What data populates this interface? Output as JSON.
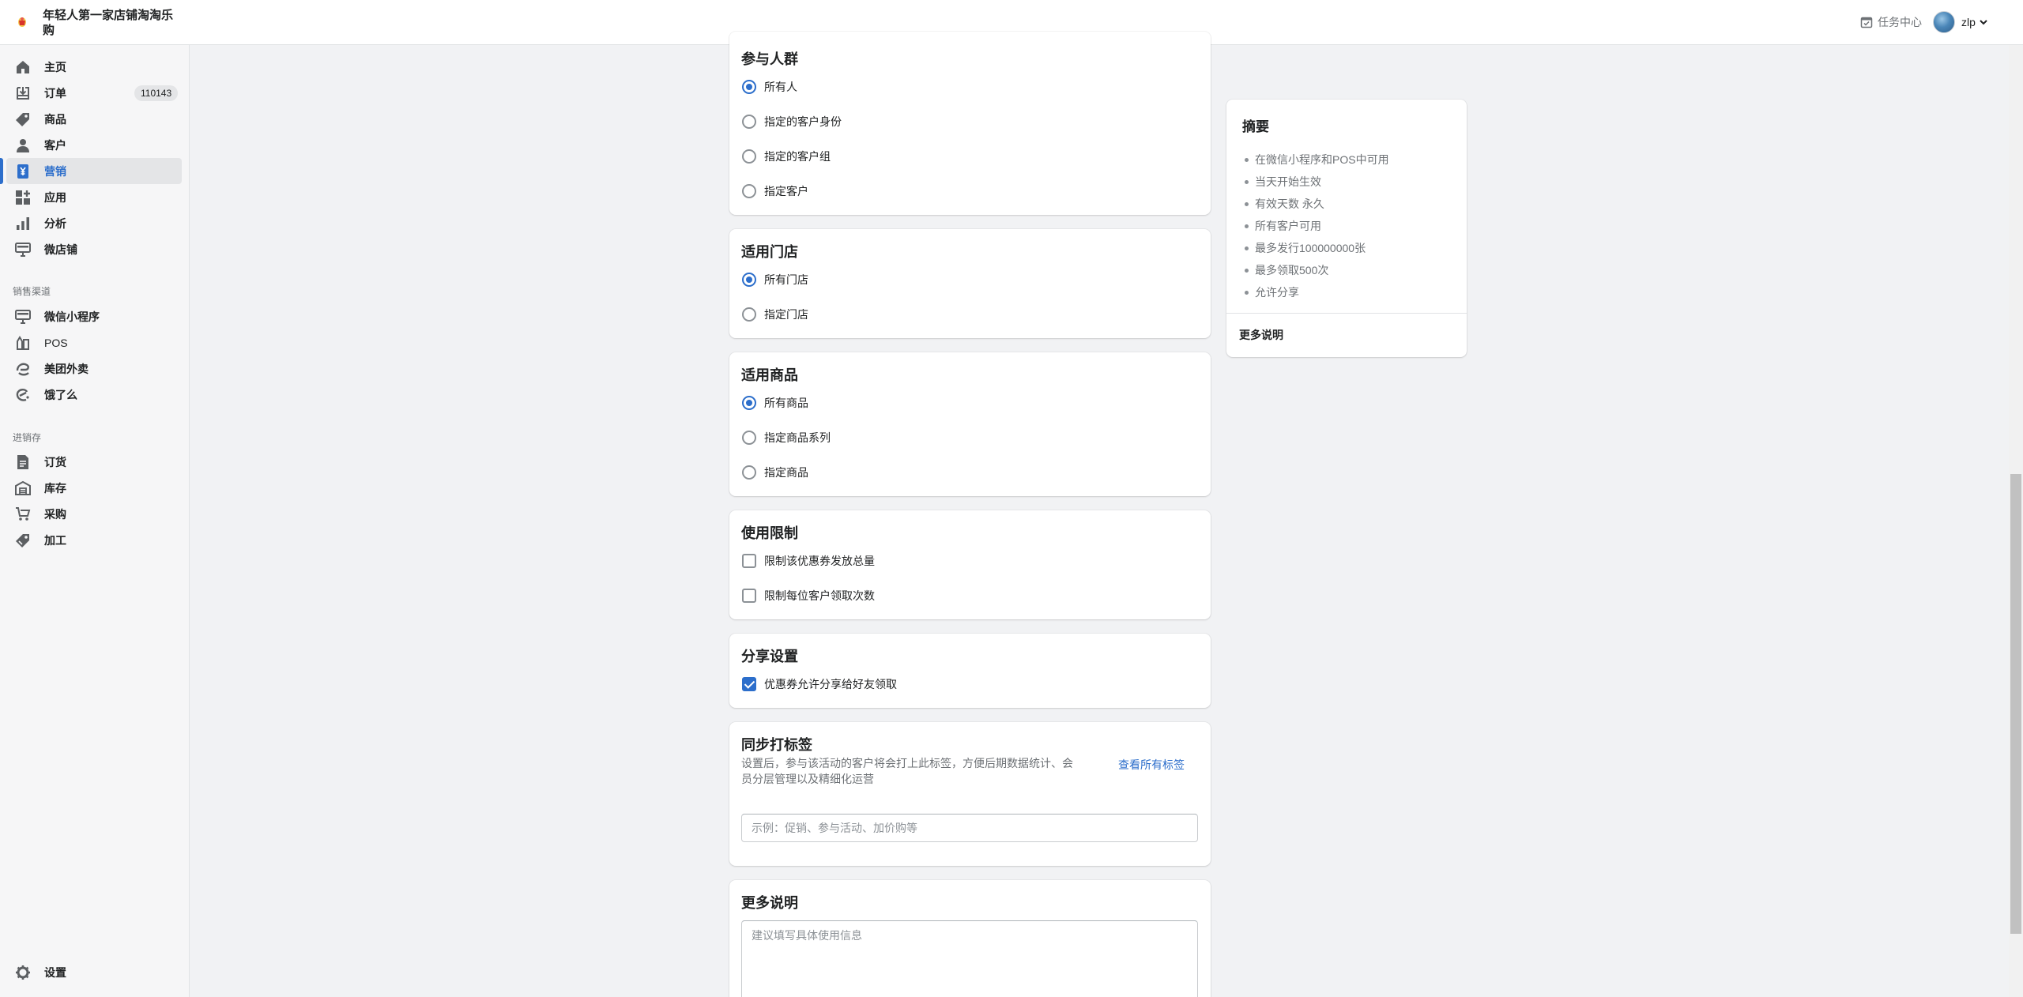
{
  "header": {
    "shop_name": "年轻人第一家店铺淘淘乐购",
    "task_center": "任务中心",
    "user_name": "zlp"
  },
  "sidebar": {
    "items": [
      {
        "label": "主页",
        "icon": "home-icon"
      },
      {
        "label": "订单",
        "icon": "order-inbox-icon",
        "badge": "110143"
      },
      {
        "label": "商品",
        "icon": "tag-icon"
      },
      {
        "label": "客户",
        "icon": "person-icon"
      },
      {
        "label": "营销",
        "icon": "yuan-icon",
        "active": true
      },
      {
        "label": "应用",
        "icon": "apps-icon"
      },
      {
        "label": "分析",
        "icon": "bar-chart-icon"
      },
      {
        "label": "微店铺",
        "icon": "storefront-icon"
      }
    ],
    "sales_section": "销售渠道",
    "sales_items": [
      {
        "label": "微信小程序",
        "icon": "miniprogram-icon"
      },
      {
        "label": "POS",
        "icon": "pos-icon"
      },
      {
        "label": "美团外卖",
        "icon": "meituan-icon"
      },
      {
        "label": "饿了么",
        "icon": "eleme-icon"
      }
    ],
    "inventory_section": "进销存",
    "inventory_items": [
      {
        "label": "订货",
        "icon": "document-icon"
      },
      {
        "label": "库存",
        "icon": "warehouse-icon"
      },
      {
        "label": "采购",
        "icon": "purchase-icon"
      },
      {
        "label": "加工",
        "icon": "processing-icon"
      }
    ],
    "settings": "设置"
  },
  "audience": {
    "title": "参与人群",
    "options": [
      "所有人",
      "指定的客户身份",
      "指定的客户组",
      "指定客户"
    ],
    "selected": 0
  },
  "stores": {
    "title": "适用门店",
    "options": [
      "所有门店",
      "指定门店"
    ],
    "selected": 0
  },
  "products": {
    "title": "适用商品",
    "options": [
      "所有商品",
      "指定商品系列",
      "指定商品"
    ],
    "selected": 0
  },
  "limits": {
    "title": "使用限制",
    "options": [
      "限制该优惠券发放总量",
      "限制每位客户领取次数"
    ]
  },
  "share": {
    "title": "分享设置",
    "option": "优惠券允许分享给好友领取",
    "checked": true
  },
  "tags": {
    "title": "同步打标签",
    "description": "设置后，参与该活动的客户将会打上此标签，方便后期数据统计、会员分层管理以及精细化运营",
    "link": "查看所有标签",
    "placeholder": "示例：促销、参与活动、加价购等"
  },
  "notes": {
    "title": "更多说明",
    "placeholder": "建议填写具体使用信息"
  },
  "summary": {
    "title": "摘要",
    "items": [
      "在微信小程序和POS中可用",
      "当天开始生效",
      "有效天数 永久",
      "所有客户可用",
      "最多发行100000000张",
      "最多领取500次",
      "允许分享"
    ],
    "more": "更多说明"
  },
  "colors": {
    "accent": "#2c6ecb",
    "sidebar_bg": "#f6f6f7",
    "page_bg": "#f1f2f4"
  }
}
